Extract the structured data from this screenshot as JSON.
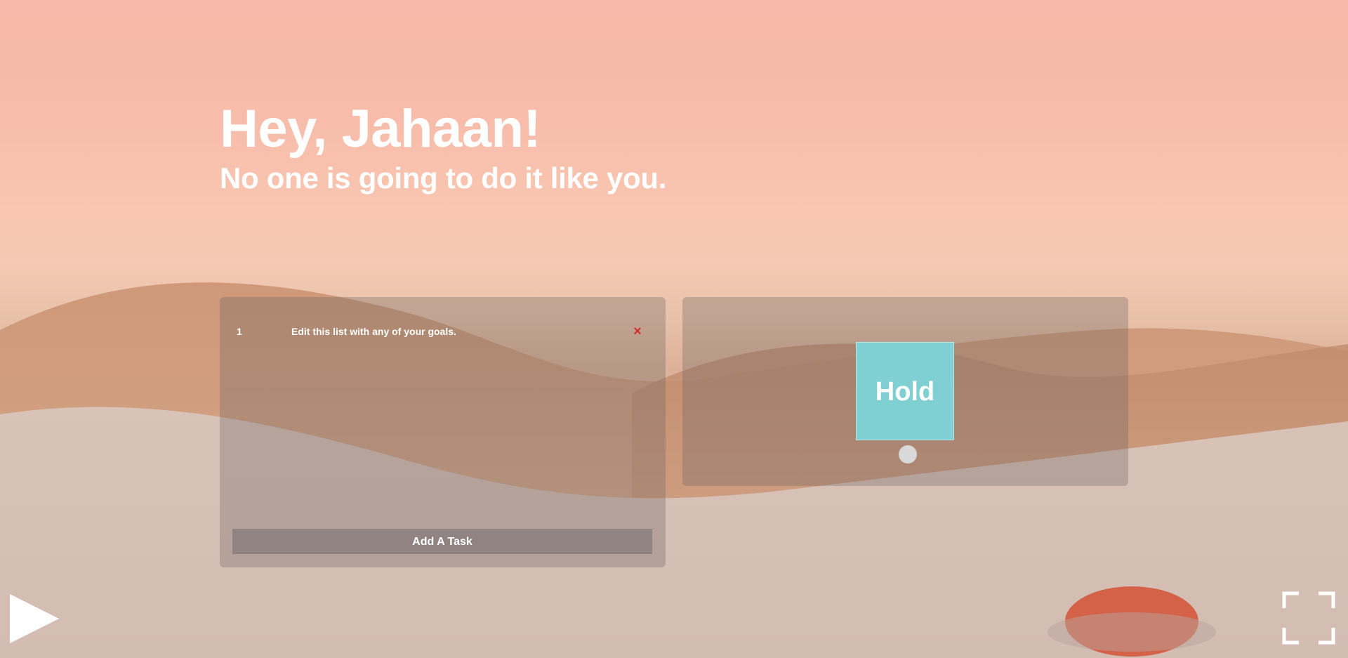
{
  "greeting": {
    "title": "Hey, Jahaan!",
    "subtitle": "No one is going to do it like you."
  },
  "todo": {
    "tasks": [
      {
        "number": "1",
        "text": "Edit this list with any of your goals.",
        "delete_icon": "×"
      }
    ],
    "add_button_label": "Add A Task"
  },
  "hold": {
    "button_label": "Hold",
    "button_color": "#7fcfd3"
  },
  "controls": {
    "play_icon": "play-icon",
    "fullscreen_icon": "fullscreen-icon"
  },
  "colors": {
    "sky": "#f6b8a8",
    "delete_accent": "#d0312d",
    "panel_overlay": "rgba(110,100,98,0.32)"
  }
}
